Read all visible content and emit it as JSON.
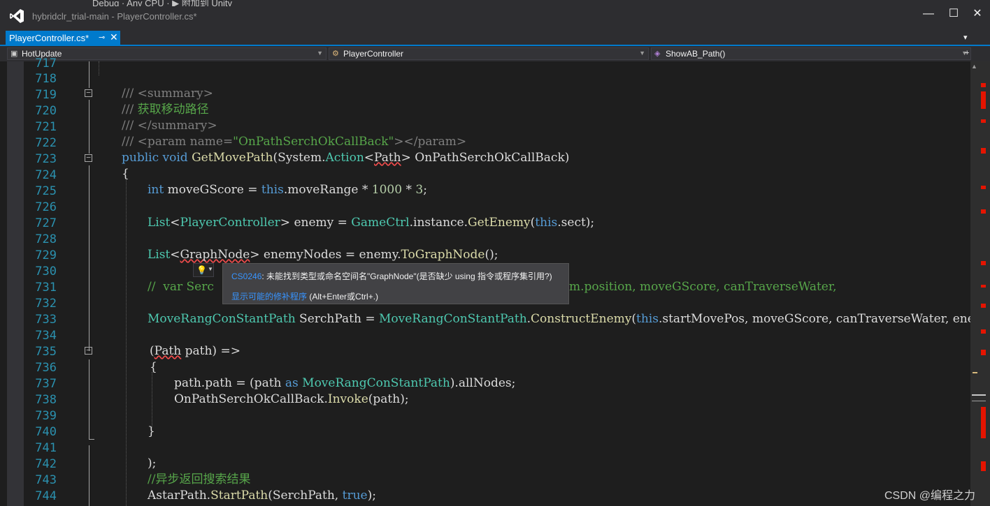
{
  "window": {
    "title": "hybridclr_trial-main - PlayerController.cs*",
    "toolbar_partial": "Debug  ·  Any CPU  ·  ▶ 附加到 Unity",
    "minimize": "—",
    "maximize": "☐",
    "close": "✕"
  },
  "tab": {
    "label": "PlayerController.cs*",
    "pin": "⊸",
    "close": "✕"
  },
  "nav": {
    "project": "HotUpdate",
    "class": "PlayerController",
    "member": "ShowAB_Path()"
  },
  "tooltip": {
    "code": "CS0246",
    "message": ": 未能找到类型或命名空间名\"GraphNode\"(是否缺少 using 指令或程序集引用?)",
    "fix_link": "显示可能的修补程序",
    "shortcut": " (Alt+Enter或Ctrl+.)"
  },
  "line_numbers": [
    "717",
    "718",
    "719",
    "720",
    "721",
    "722",
    "723",
    "724",
    "725",
    "726",
    "727",
    "728",
    "729",
    "730",
    "731",
    "732",
    "733",
    "734",
    "735",
    "736",
    "737",
    "738",
    "739",
    "740",
    "741",
    "742",
    "743",
    "744"
  ],
  "code": {
    "l719": {
      "a": "/// ",
      "b": "<summary>"
    },
    "l720": {
      "a": "/// ",
      "b": "获取移动路径"
    },
    "l721": {
      "a": "/// ",
      "b": "</summary>"
    },
    "l722": {
      "a": "/// ",
      "b": "<param name=",
      "c": "\"OnPathSerchOkCallBack\"",
      "d": "></param>"
    },
    "l723": {
      "kw1": "public",
      "kw2": "void",
      "fn": "GetMovePath",
      "ns": "System",
      "dot": ".",
      "act": "Action",
      "lt": "<",
      "path": "Path",
      "gt": ">",
      "param": "OnPathSerchOkCallBack",
      "rp": ")"
    },
    "l724": "{",
    "l725": {
      "kw": "int",
      "rest1": " moveGScore = ",
      "this": "this",
      "rest2": ".moveRange * ",
      "n1": "1000",
      "mul": " * ",
      "n2": "3",
      "semi": ";"
    },
    "l727": {
      "list": "List",
      "lt": "<",
      "pc": "PlayerController",
      "gt": ">",
      "mid": " enemy = ",
      "gc": "GameCtrl",
      "rest": ".instance.",
      "fn": "GetEnemy",
      "p1": "(",
      "this": "this",
      "rest2": ".sect);"
    },
    "l729": {
      "list": "List",
      "lt": "<",
      "gn": "GraphNode",
      "gt": ">",
      "mid": " enemyNodes = enemy.",
      "fn": "ToGraphNode",
      "end": "();"
    },
    "l731": {
      "a": "//  var Serc",
      "b": "m.position, moveGScore, canTraverseWater,"
    },
    "l733": {
      "t1": "MoveRangConStantPath",
      "mid": " SerchPath = ",
      "t2": "MoveRangConStantPath",
      "dot": ".",
      "fn": "ConstructEnemy",
      "p": "(",
      "this": "this",
      "rest": ".startMovePos, moveGScore, canTraverseWater, enemyNod"
    },
    "l735": {
      "lp": "(",
      "path": "Path",
      "rest": " path) =>"
    },
    "l736": "{",
    "l737": {
      "a": "path.path = (path ",
      "as": "as",
      "sp": " ",
      "t": "MoveRangConStantPath",
      "b": ").allNodes;"
    },
    "l738": {
      "a": "OnPathSerchOkCallBack.",
      "fn": "Invoke",
      "b": "(path);"
    },
    "l740": "}",
    "l742": ");",
    "l743": "//异步返回搜索结果",
    "l744": {
      "a": "AstarPath.",
      "fn": "StartPath",
      "b": "(SerchPath, ",
      "kw": "true",
      "c": ");"
    }
  },
  "watermark": "CSDN @编程之力",
  "colors": {
    "accent": "#007acc",
    "keyword": "#569cd6",
    "type": "#4ec9b0",
    "comment": "#57a64a",
    "line_number": "#2b91af",
    "error": "#e51400"
  }
}
